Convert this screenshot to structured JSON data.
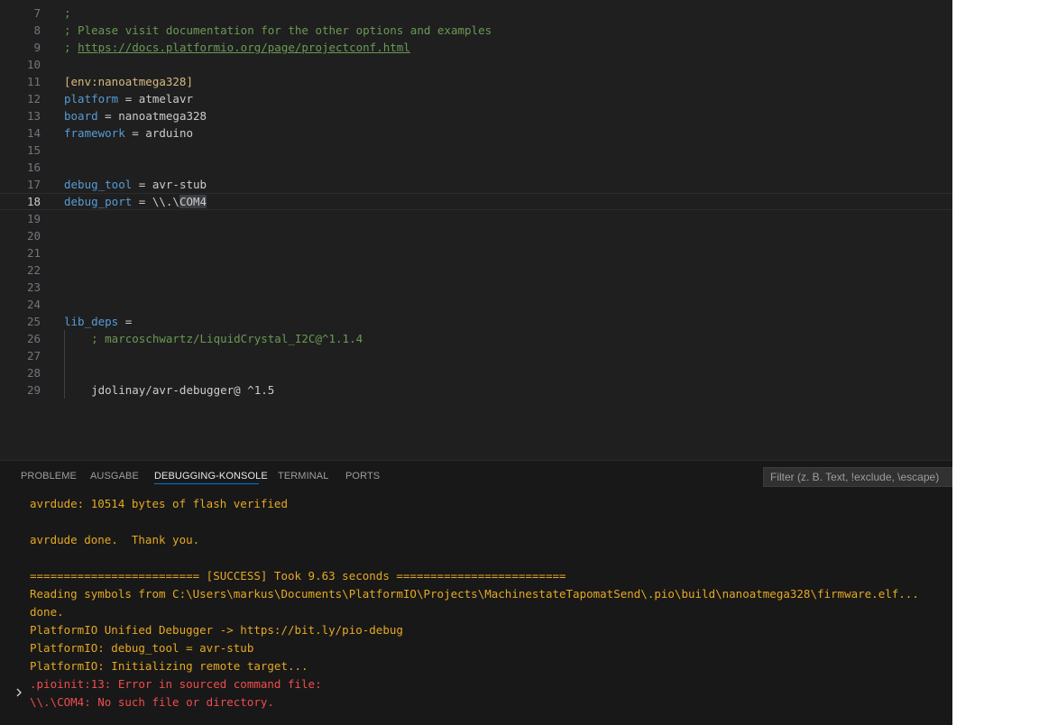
{
  "editor": {
    "lines": [
      {
        "num": "7",
        "tokens": [
          {
            "t": ";",
            "c": "comment"
          }
        ]
      },
      {
        "num": "8",
        "tokens": [
          {
            "t": "; Please visit documentation for the other options and examples",
            "c": "comment"
          }
        ]
      },
      {
        "num": "9",
        "tokens": [
          {
            "t": "; ",
            "c": "comment"
          },
          {
            "t": "https://docs.platformio.org/page/projectconf.html",
            "c": "link"
          }
        ]
      },
      {
        "num": "10",
        "tokens": []
      },
      {
        "num": "11",
        "tokens": [
          {
            "t": "[env:nanoatmega328]",
            "c": "section"
          }
        ]
      },
      {
        "num": "12",
        "tokens": [
          {
            "t": "platform",
            "c": "key"
          },
          {
            "t": " = atmelavr",
            "c": "text"
          }
        ]
      },
      {
        "num": "13",
        "tokens": [
          {
            "t": "board",
            "c": "key"
          },
          {
            "t": " = nanoatmega328",
            "c": "text"
          }
        ]
      },
      {
        "num": "14",
        "tokens": [
          {
            "t": "framework",
            "c": "key"
          },
          {
            "t": " = arduino",
            "c": "text"
          }
        ]
      },
      {
        "num": "15",
        "tokens": []
      },
      {
        "num": "16",
        "tokens": []
      },
      {
        "num": "17",
        "tokens": [
          {
            "t": "debug_tool",
            "c": "key"
          },
          {
            "t": " = avr-stub",
            "c": "text"
          }
        ]
      },
      {
        "num": "18",
        "current": true,
        "tokens": [
          {
            "t": "debug_port",
            "c": "key"
          },
          {
            "t": " = \\\\.\\",
            "c": "text"
          },
          {
            "t": "COM4",
            "c": "sel"
          }
        ]
      },
      {
        "num": "19",
        "tokens": []
      },
      {
        "num": "20",
        "tokens": []
      },
      {
        "num": "21",
        "tokens": []
      },
      {
        "num": "22",
        "tokens": []
      },
      {
        "num": "23",
        "tokens": []
      },
      {
        "num": "24",
        "tokens": []
      },
      {
        "num": "25",
        "tokens": [
          {
            "t": "lib_deps",
            "c": "key"
          },
          {
            "t": " =",
            "c": "text"
          }
        ]
      },
      {
        "num": "26",
        "indent": true,
        "tokens": [
          {
            "t": "    ; marcoschwartz/LiquidCrystal_I2C@^1.1.4",
            "c": "comment"
          }
        ]
      },
      {
        "num": "27",
        "indent": true,
        "tokens": []
      },
      {
        "num": "28",
        "indent": true,
        "tokens": []
      },
      {
        "num": "29",
        "indent": true,
        "tokens": [
          {
            "t": "    jdolinay/avr-debugger@ ^1.5",
            "c": "text"
          }
        ]
      }
    ]
  },
  "panel": {
    "tabs": [
      {
        "label": "PROBLEME",
        "name": "tab-probleme",
        "active": false
      },
      {
        "label": "AUSGABE",
        "name": "tab-ausgabe",
        "active": false
      },
      {
        "label": "DEBUGGING-KONSOLE",
        "name": "tab-debugging-konsole",
        "active": true
      },
      {
        "label": "TERMINAL",
        "name": "tab-terminal",
        "active": false
      },
      {
        "label": "PORTS",
        "name": "tab-ports",
        "active": false
      }
    ],
    "filter_placeholder": "Filter (z. B. Text, !exclude, \\escape)",
    "console_lines": [
      {
        "t": "avrdude: 10514 bytes of flash verified",
        "c": "info"
      },
      {
        "t": "",
        "c": "info"
      },
      {
        "t": "avrdude done.  Thank you.",
        "c": "info"
      },
      {
        "t": "",
        "c": "info"
      },
      {
        "t": "========================= [SUCCESS] Took 9.63 seconds =========================",
        "c": "info"
      },
      {
        "t": "Reading symbols from C:\\Users\\markus\\Documents\\PlatformIO\\Projects\\MachinestateTapomatSend\\.pio\\build\\nanoatmega328\\firmware.elf...",
        "c": "info"
      },
      {
        "t": "done.",
        "c": "info"
      },
      {
        "t": "PlatformIO Unified Debugger -> https://bit.ly/pio-debug",
        "c": "info"
      },
      {
        "t": "PlatformIO: debug_tool = avr-stub",
        "c": "info"
      },
      {
        "t": "PlatformIO: Initializing remote target...",
        "c": "info"
      },
      {
        "t": ".pioinit:13: Error in sourced command file:",
        "c": "error"
      },
      {
        "t": "\\\\.\\COM4: No such file or directory.",
        "c": "error"
      }
    ]
  },
  "colors": {
    "editor_bg": "#1f1f1f",
    "panel_bg": "#181818",
    "comment": "#6a9955",
    "key": "#569cd6",
    "section": "#d7ba7d",
    "console_info": "#e5a823",
    "console_error": "#f14c4c",
    "active_tab_border": "#0078d4"
  }
}
